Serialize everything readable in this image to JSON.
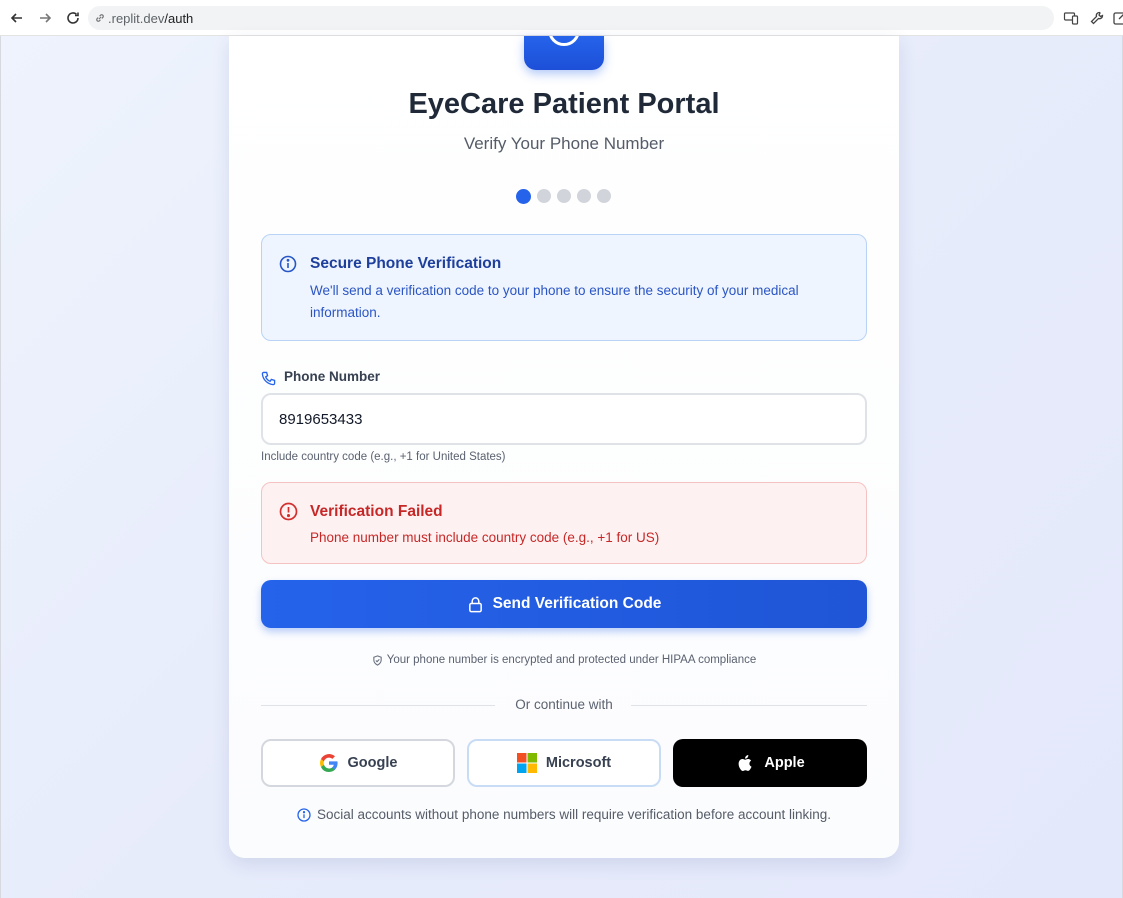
{
  "browser": {
    "url_host": ".replit.dev",
    "url_path": "/auth"
  },
  "portal": {
    "title": "EyeCare Patient Portal",
    "subtitle": "Verify Your Phone Number",
    "steps_total": 5,
    "steps_current": 1
  },
  "info": {
    "title": "Secure Phone Verification",
    "text": "We'll send a verification code to your phone to ensure the security of your medical information."
  },
  "phone_field": {
    "label": "Phone Number",
    "value": "8919653433",
    "helper": "Include country code (e.g., +1 for United States)"
  },
  "error": {
    "title": "Verification Failed",
    "text": "Phone number must include country code (e.g., +1 for US)"
  },
  "actions": {
    "send_label": "Send Verification Code",
    "security_note": "Your phone number is encrypted and protected under HIPAA compliance",
    "divider_label": "Or continue with"
  },
  "social": {
    "google_label": "Google",
    "microsoft_label": "Microsoft",
    "apple_label": "Apple",
    "note": "Social accounts without phone numbers will require verification before account linking."
  },
  "colors": {
    "accent": "#2563eb",
    "error": "#c62828",
    "info": "#1e3f9c"
  }
}
